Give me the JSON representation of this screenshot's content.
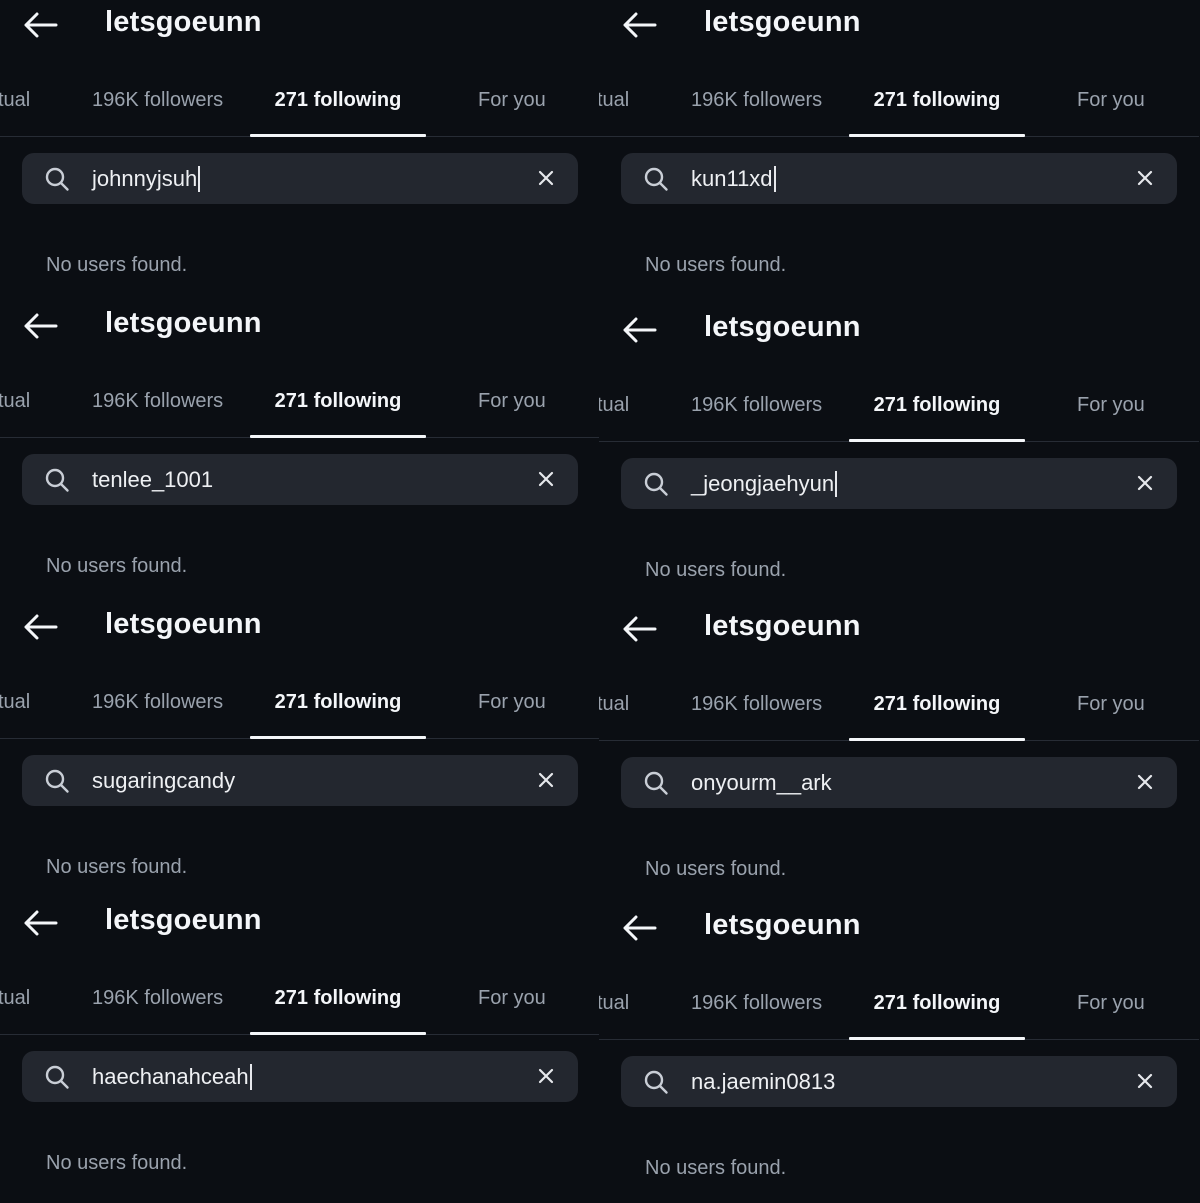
{
  "screens": [
    {
      "username": "letsgoeunn",
      "tabs": {
        "mutual": "tual",
        "followers": "196K followers",
        "following": "271 following",
        "for_you": "For you"
      },
      "search": {
        "query": "johnnyjsuh",
        "caret": true
      },
      "empty_message": "No users found."
    },
    {
      "username": "letsgoeunn",
      "tabs": {
        "mutual": "tual",
        "followers": "196K followers",
        "following": "271 following",
        "for_you": "For you"
      },
      "search": {
        "query": "kun11xd",
        "caret": true
      },
      "empty_message": "No users found."
    },
    {
      "username": "letsgoeunn",
      "tabs": {
        "mutual": "tual",
        "followers": "196K followers",
        "following": "271 following",
        "for_you": "For you"
      },
      "search": {
        "query": "tenlee_1001",
        "caret": false
      },
      "empty_message": "No users found."
    },
    {
      "username": "letsgoeunn",
      "tabs": {
        "mutual": "tual",
        "followers": "196K followers",
        "following": "271 following",
        "for_you": "For you"
      },
      "search": {
        "query": "_jeongjaehyun",
        "caret": true
      },
      "empty_message": "No users found."
    },
    {
      "username": "letsgoeunn",
      "tabs": {
        "mutual": "tual",
        "followers": "196K followers",
        "following": "271 following",
        "for_you": "For you"
      },
      "search": {
        "query": "sugaringcandy",
        "caret": false
      },
      "empty_message": "No users found."
    },
    {
      "username": "letsgoeunn",
      "tabs": {
        "mutual": "tual",
        "followers": "196K followers",
        "following": "271 following",
        "for_you": "For you"
      },
      "search": {
        "query": "onyourm__ark",
        "caret": false
      },
      "empty_message": "No users found."
    },
    {
      "username": "letsgoeunn",
      "tabs": {
        "mutual": "tual",
        "followers": "196K followers",
        "following": "271 following",
        "for_you": "For you"
      },
      "search": {
        "query": "haechanahceah",
        "caret": true
      },
      "empty_message": "No users found."
    },
    {
      "username": "letsgoeunn",
      "tabs": {
        "mutual": "tual",
        "followers": "196K followers",
        "following": "271 following",
        "for_you": "For you"
      },
      "search": {
        "query": "na.jaemin0813",
        "caret": false
      },
      "empty_message": "No users found."
    }
  ],
  "icons": {
    "back": "arrow-left-icon",
    "search": "search-icon",
    "clear": "close-icon"
  },
  "colors": {
    "background": "#0b0e13",
    "search_field": "#23272f",
    "muted_text": "#9aa2ad",
    "active_text": "#f4f6f9",
    "divider": "#272c35"
  }
}
